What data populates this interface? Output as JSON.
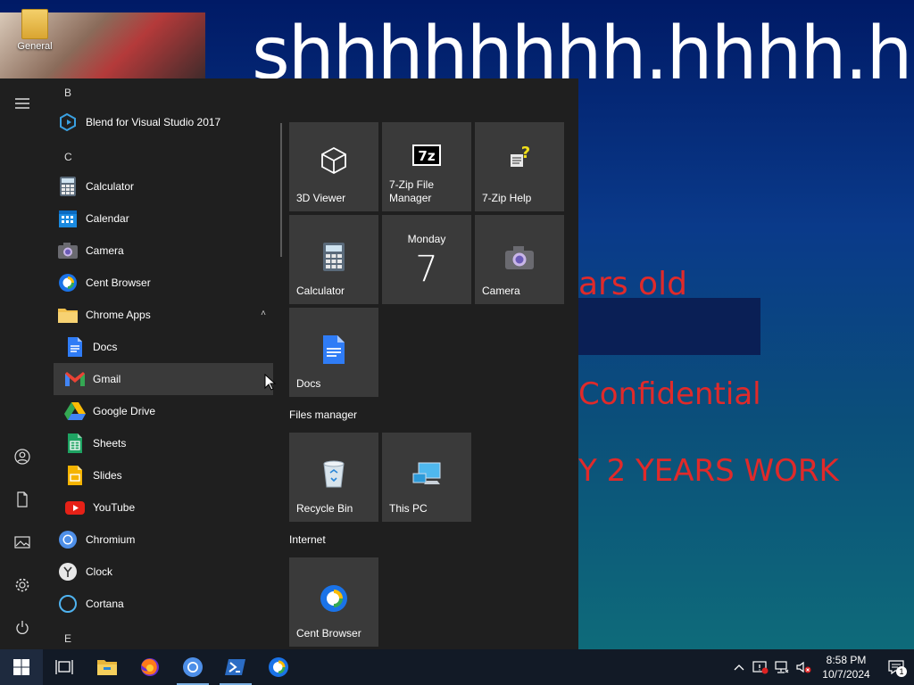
{
  "desktop": {
    "icon_label": "General",
    "wallpaper_text": {
      "big": "shhhhhhhh.hhhh.hhhh",
      "line1": "ars old",
      "line2": "Confidential",
      "line3": "Y 2 YEARS WORK"
    }
  },
  "start_menu": {
    "groups": {
      "b": "B",
      "c": "C",
      "e": "E"
    },
    "apps": {
      "blend": "Blend for Visual Studio 2017",
      "calculator": "Calculator",
      "calendar": "Calendar",
      "camera": "Camera",
      "cent_browser": "Cent Browser",
      "chrome_apps": "Chrome Apps",
      "docs": "Docs",
      "gmail": "Gmail",
      "google_drive": "Google Drive",
      "sheets": "Sheets",
      "slides": "Slides",
      "youtube": "YouTube",
      "chromium": "Chromium",
      "clock": "Clock",
      "cortana": "Cortana"
    },
    "tiles": {
      "viewer3d": "3D Viewer",
      "zip_manager": "7-Zip File Manager",
      "zip_help": "7-Zip Help",
      "calculator": "Calculator",
      "calendar_day": "Monday",
      "calendar_date": "7",
      "camera": "Camera",
      "docs": "Docs",
      "files_section": "Files manager",
      "recycle_bin": "Recycle Bin",
      "this_pc": "This PC",
      "internet_section": "Internet",
      "cent_browser": "Cent Browser"
    }
  },
  "taskbar": {
    "time": "8:58 PM",
    "date": "10/7/2024",
    "notification_count": "1"
  },
  "colors": {
    "start_bg": "#1f1f1f",
    "tile_bg": "#3a3a3a",
    "taskbar_bg": "#121a26",
    "wallpaper_red": "#e02a2a"
  }
}
